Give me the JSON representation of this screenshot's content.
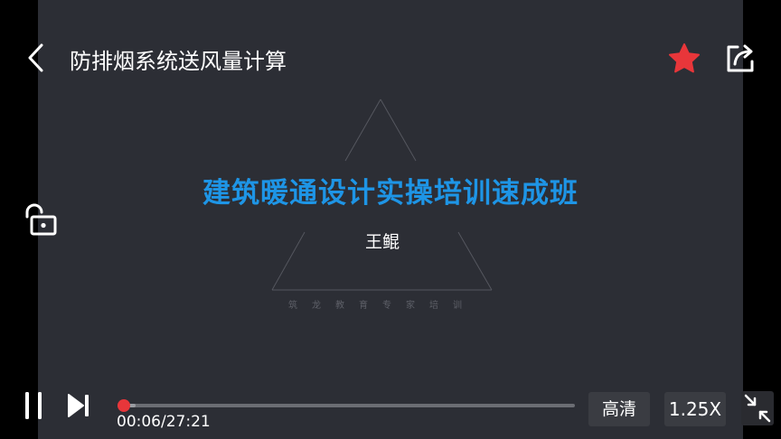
{
  "header": {
    "title": "防排烟系统送风量计算",
    "back_icon": "chevron-left-icon",
    "favorite_icon": "star-icon",
    "share_icon": "share-icon"
  },
  "slide": {
    "title": "建筑暖通设计实操培训速成班",
    "author": "王鲲",
    "watermark": "筑龙教育专家培训"
  },
  "side_controls": {
    "lock_icon": "unlock-icon"
  },
  "player": {
    "current_time": "00:06",
    "duration": "27:21",
    "time_separator": "/",
    "progress_fraction": 0.004,
    "buffered_fraction": 0.04,
    "quality_label": "高清",
    "speed_label": "1.25X",
    "pause_icon": "pause-icon",
    "next_icon": "skip-next-icon",
    "exit_fullscreen_icon": "exit-fullscreen-icon"
  },
  "colors": {
    "accent": "#e8363a",
    "slide_title": "#1e95e6",
    "slide_background": "#2c2e35"
  }
}
